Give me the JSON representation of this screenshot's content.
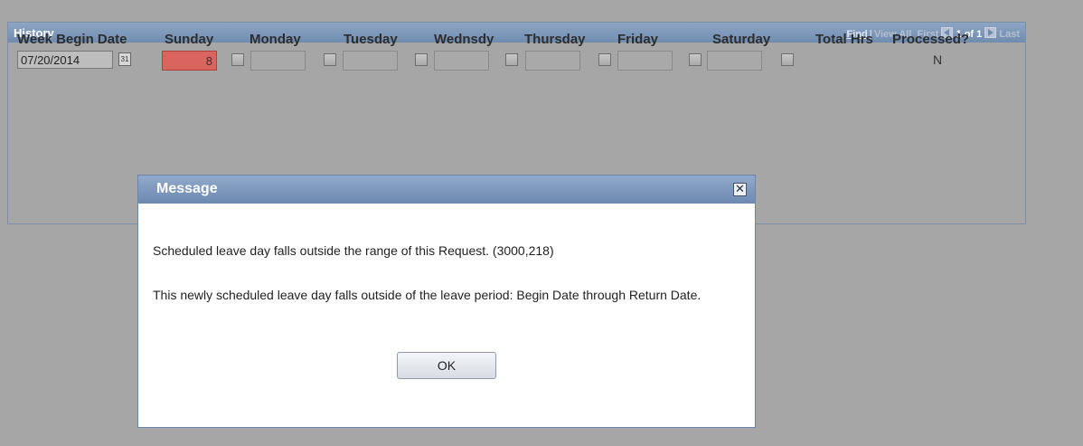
{
  "grid": {
    "title": "History",
    "nav": {
      "find": "Find",
      "separator": "|",
      "view_all": "View All",
      "first": "First",
      "position": "1 of 1",
      "last": "Last"
    },
    "columns": [
      "Week Begin Date",
      "Sunday",
      "Monday",
      "Tuesday",
      "Wednsdy",
      "Thursday",
      "Friday",
      "Saturday",
      "Total Hrs",
      "Processed?"
    ],
    "row": {
      "week_begin_date": "07/20/2014",
      "calendar_icon": "calendar-icon",
      "calendar_glyph": "31",
      "days": {
        "sunday": "8",
        "monday": "",
        "tuesday": "",
        "wednesday": "",
        "thursday": "",
        "friday": "",
        "saturday": ""
      },
      "total_hrs": "",
      "processed": "N"
    }
  },
  "dialog": {
    "title": "Message",
    "close_glyph": "✕",
    "message_line1": "Scheduled leave day falls outside the range of this Request. (3000,218)",
    "message_line2": "This newly scheduled leave day falls outside of the leave period: Begin Date through Return Date.",
    "ok_label": "OK"
  },
  "colors": {
    "error_field": "#d9655e",
    "header_blue": "#6f8cb0",
    "overlay_gray": "#a6a6a6"
  }
}
